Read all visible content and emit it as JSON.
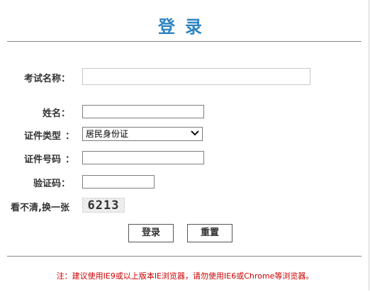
{
  "page": {
    "title": "登录"
  },
  "form": {
    "exam_name": {
      "label": "考试名称：",
      "value": "",
      "placeholder": ""
    },
    "name": {
      "label": "姓名：",
      "value": "",
      "placeholder": ""
    },
    "id_type": {
      "label": "证件类型",
      "selected": "居民身份证",
      "icon": "chevron-down-icon"
    },
    "id_number": {
      "label": "证件号码",
      "value": "",
      "placeholder": ""
    },
    "verify_code": {
      "label": "验证码：",
      "value": "",
      "placeholder": ""
    },
    "captcha": {
      "label": "看不清,换一张",
      "code": "6213"
    }
  },
  "buttons": {
    "login": "登录",
    "reset": "重置"
  },
  "footer": {
    "note": "注：建议使用IE9或以上版本IE浏览器，请勿使用IE6或Chrome等浏览器。"
  },
  "colors": {
    "title": "#2e84c1",
    "note": "#cc0000"
  }
}
